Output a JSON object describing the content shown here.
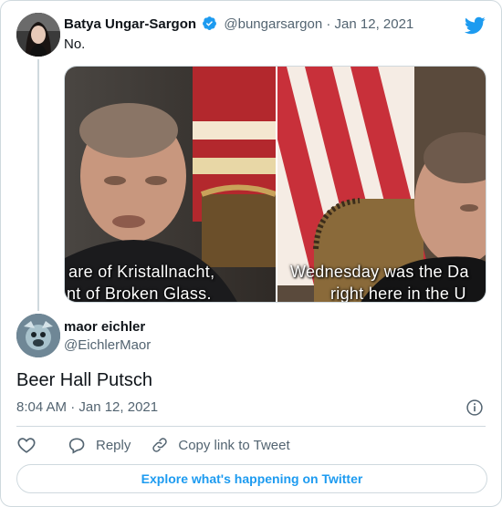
{
  "parent_tweet": {
    "author_name": "Batya Ungar-Sargon",
    "handle": "@bungarsargon",
    "separator": "·",
    "date": "Jan 12, 2021",
    "text": "No.",
    "media": {
      "left_subtitle_line1": "are of Kristallnacht,",
      "left_subtitle_line2": "nt of Broken Glass.",
      "right_subtitle_line1": "Wednesday was the Da",
      "right_subtitle_line2": "right here in the U"
    }
  },
  "reply_tweet": {
    "author_name": "maor eichler",
    "handle": "@EichlerMaor",
    "text": "Beer Hall Putsch",
    "timestamp": "8:04 AM · Jan 12, 2021"
  },
  "actions": {
    "reply_label": "Reply",
    "copy_link_label": "Copy link to Tweet"
  },
  "explore_label": "Explore what's happening on Twitter",
  "colors": {
    "accent": "#1d9bf0",
    "secondary_text": "#536471",
    "border": "#cfd9de"
  },
  "icons": [
    "verified-badge-icon",
    "twitter-bird-icon",
    "info-icon",
    "heart-icon",
    "reply-bubble-icon",
    "link-icon"
  ]
}
